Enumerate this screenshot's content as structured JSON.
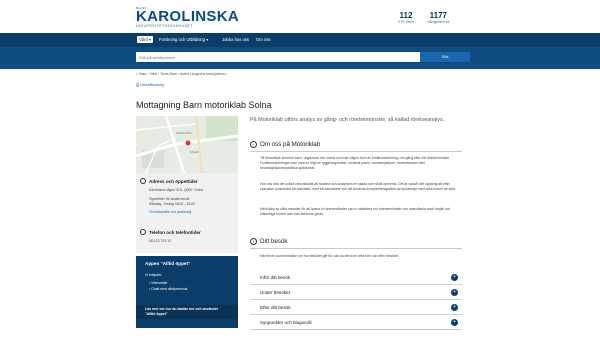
{
  "header": {
    "logo_small": "BLAST",
    "logo_text": "KAROLINSKA",
    "logo_sub": "UNIVERSITETSSJUKHUSET",
    "stats": [
      {
        "number": "112",
        "label": "KTK Karln"
      },
      {
        "number": "1177",
        "label": "Vårdguiden.se"
      }
    ]
  },
  "nav": {
    "items": [
      "Vård",
      "Forskning och Utbildning",
      "Jobba hos oss",
      "Om oss"
    ]
  },
  "search": {
    "placeholder": "Sök på webbplatsen",
    "button_label": "Sök"
  },
  "breadcrumb": "Start › Vård › Tema Barn › Astrid Lindgrens barnsjukhus ›",
  "print_label": "Utskriftsvänlig",
  "page_title": "Mottagning Barn motoriklab Solna",
  "map": {
    "labels": [
      "KAROLINSKA",
      "VÄGEN"
    ]
  },
  "address": {
    "heading": "Adress och öppettider",
    "line1": "Karolinska vägen 37A, Q0B7, Solna",
    "line2": "Öppettider för lokala besök",
    "line3": "Måndag - fredag 08.00 - 15.00",
    "line4": "Om tidsahalle och parkering"
  },
  "phone": {
    "heading": "Telefon och telefontider",
    "number": "08-123 703 13"
  },
  "app": {
    "title": "Appen \"Alltid öppet\"",
    "intro": "Vi erbjuder:",
    "items": [
      "Videomöte",
      "Chatt med vårdpersonal"
    ],
    "cta": "Läs mer om hur du laddar ner och använder \"Alltid öppet\""
  },
  "intro_text": "På Motoriklab utförs analys av gång- och rörelsemönster, så kallad rörelseanalys.",
  "about": {
    "title": "Om oss på Motoriklab",
    "para1": "Till Motoriklab kommer barn, ungdomar och vuxna som har någon form av funktionsstörning i sin gång eller sitt rörelsemönster. Funktionsstörningen kan vara en följd av ryggmärgsbråck, cerebral pares, muskelsjukdom, muskelskador eller neurologiska/ortopediska sjukdomar.",
    "para2": "Hos oss kan det också vara aktuellt att studera och analysera en skada som skall opereras. Det är också vårt uppdrag att efter operation undersöka ett resultatet, med ett samarbete och att använda komplexitetsgraden av fysioterapi med olika former av stöd.",
    "para3": "Med hjälp av olika metoder för att ljusna in rörelsemönster kan vi utvärdera hur rörelsemönster och utvecklas/a dock forgår och väsentliga former som kan behövas göras."
  },
  "visit": {
    "title": "Ditt besök",
    "intro": "Här finner du information om hur besöket går till, vad du behöver veta före och efter besöket.",
    "items": [
      "Inför ditt besök",
      "Under besöket",
      "Efter ditt besök",
      "Synpunkter och klagomål"
    ]
  }
}
